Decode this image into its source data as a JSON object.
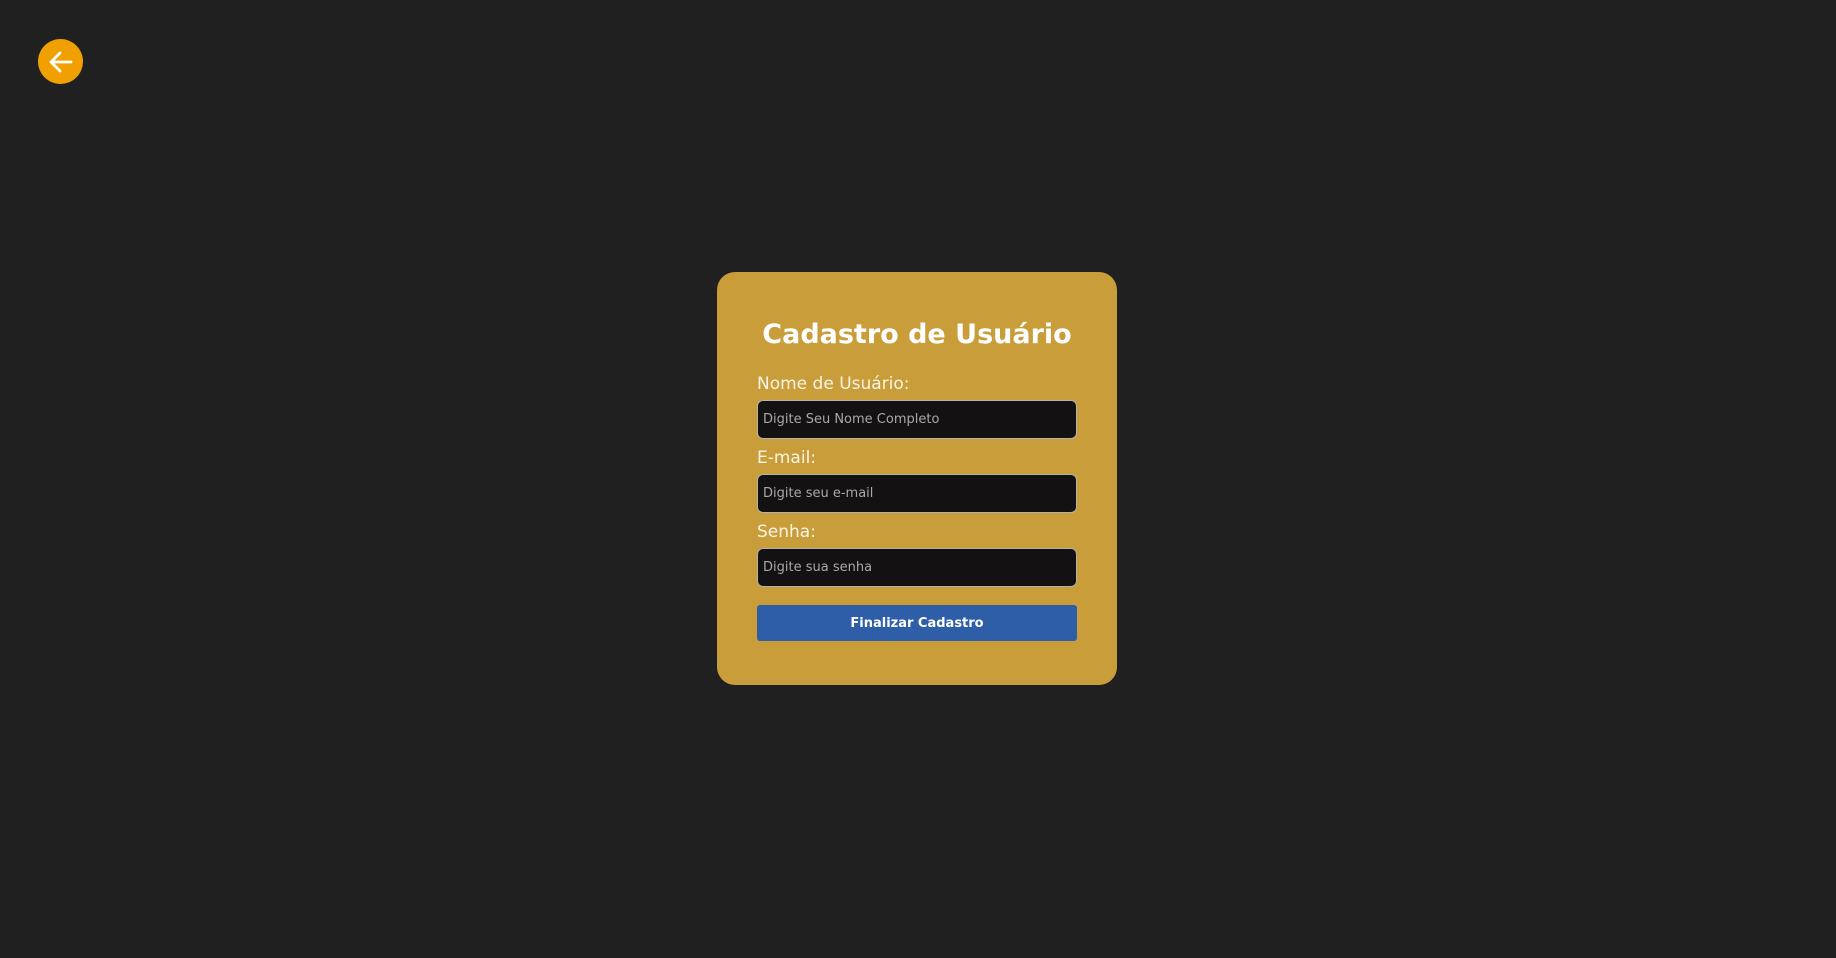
{
  "nav": {
    "back_icon": "arrow-left-icon"
  },
  "form": {
    "title": "Cadastro de Usuário",
    "fields": [
      {
        "label": "Nome de Usuário:",
        "placeholder": "Digite Seu Nome Completo",
        "value": ""
      },
      {
        "label": "E-mail:",
        "placeholder": "Digite seu e-mail",
        "value": ""
      },
      {
        "label": "Senha:",
        "placeholder": "Digite sua senha",
        "value": ""
      }
    ],
    "submit_label": "Finalizar Cadastro"
  },
  "colors": {
    "background": "#202020",
    "card": "#c99d3a",
    "back_button": "#f0a000",
    "submit_button": "#2e5ea7",
    "input_background": "#141112"
  }
}
